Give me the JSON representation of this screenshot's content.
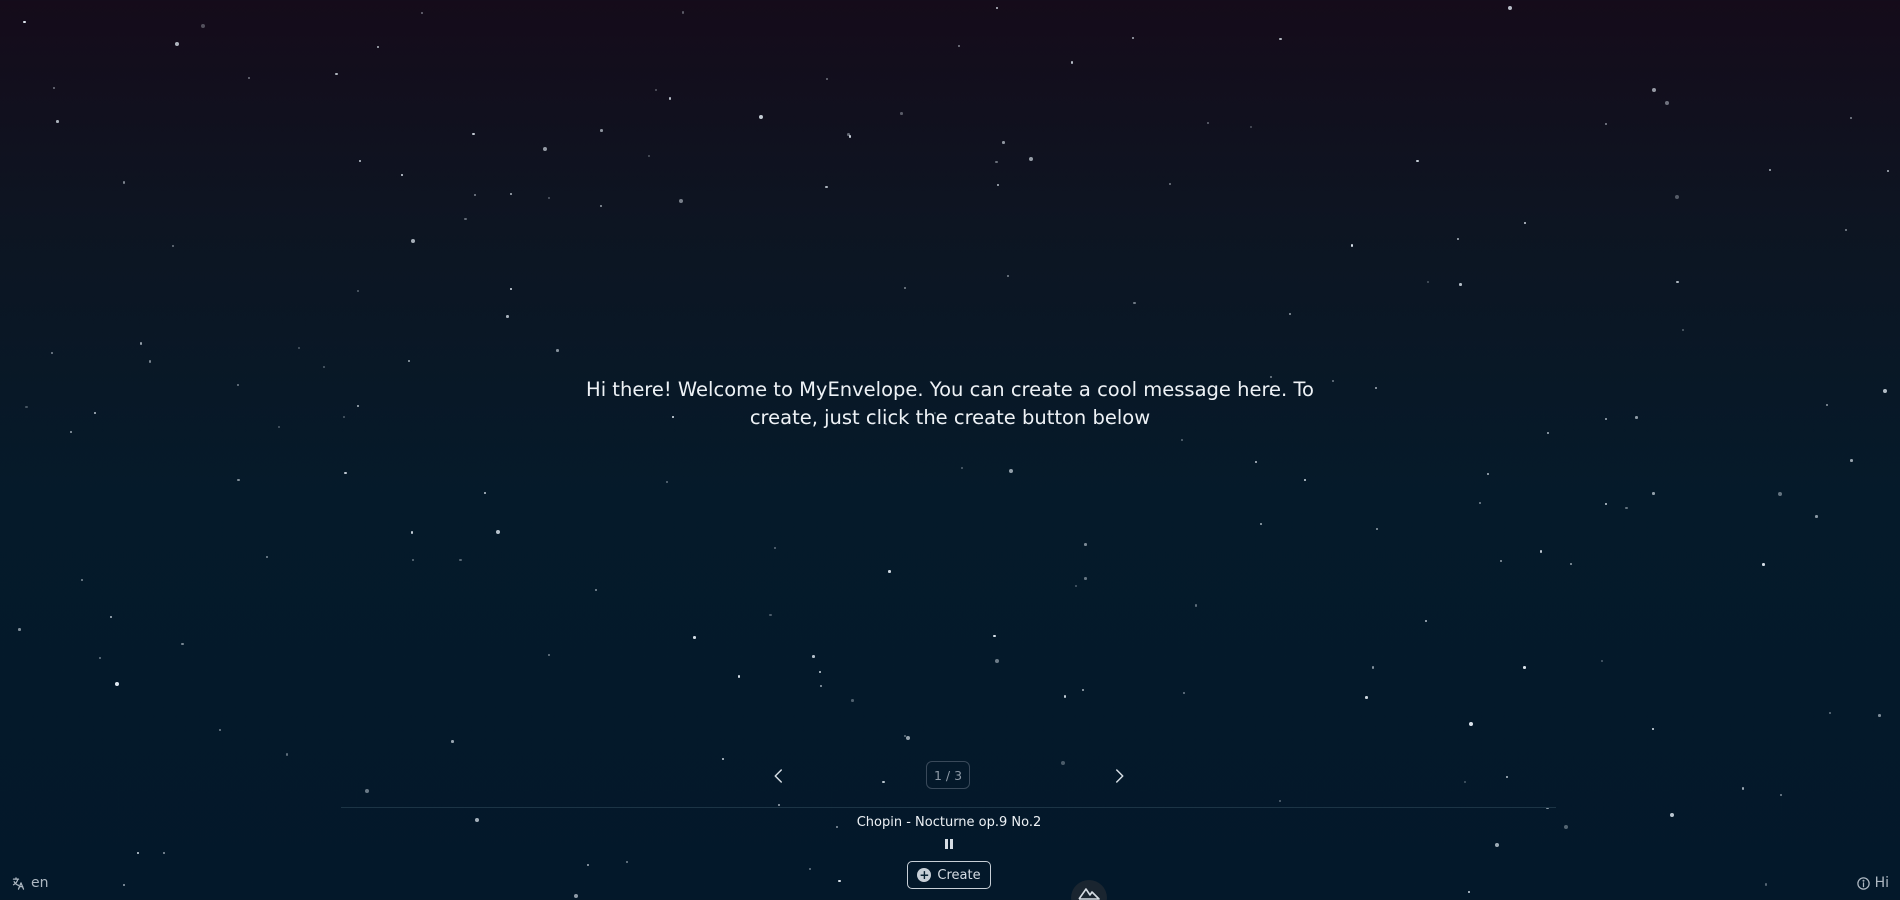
{
  "welcome": {
    "message": "Hi there! Welcome to MyEnvelope. You can create a cool message here. To create, just click the create button below"
  },
  "carousel": {
    "page_indicator": "1 / 3",
    "prev_icon": "chevron-left-icon",
    "next_icon": "chevron-right-icon"
  },
  "music": {
    "song_title": "Chopin - Nocturne op.9 No.2",
    "state_icon": "pause-icon"
  },
  "actions": {
    "create_label": "Create",
    "create_icon": "plus-circle-icon"
  },
  "language": {
    "code": "en",
    "icon": "translate-icon"
  },
  "info": {
    "label": "Hi",
    "icon": "info-icon"
  },
  "logo": {
    "icon": "mountain-logo-icon"
  },
  "colors": {
    "background_top": "#150b1a",
    "background_bottom": "#03182a",
    "text": "#eef2f6",
    "muted": "#8d99a6",
    "star": "#dfe8f0"
  }
}
